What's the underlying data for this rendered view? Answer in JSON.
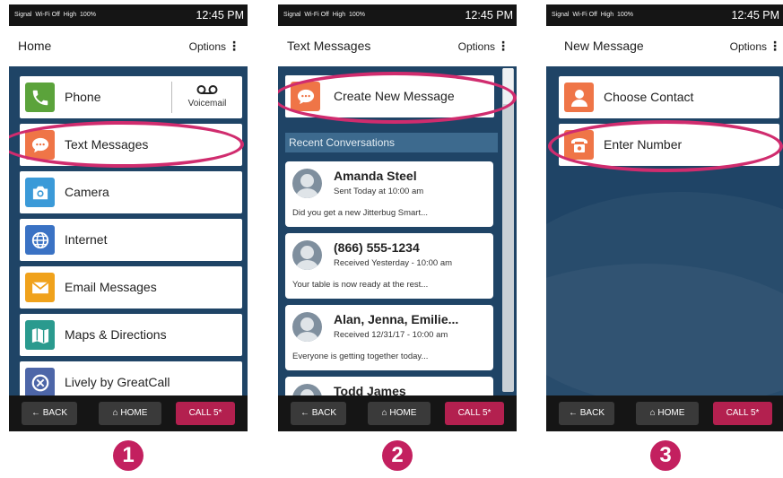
{
  "status_bar": {
    "signal": "Signal",
    "wifi": "Wi-Fi Off",
    "volume": "High",
    "battery": "100%",
    "time": "12:45 PM"
  },
  "nav": {
    "back": "BACK",
    "home": "HOME",
    "call": "CALL 5*"
  },
  "colors": {
    "background": "#1f4466",
    "highlight": "#d02c6e",
    "call_button": "#b3204f",
    "badge": "#c3205f"
  },
  "screen1": {
    "title": "Home",
    "options": "Options",
    "phone_label": "Phone",
    "voicemail_label": "Voicemail",
    "voicemail_icon": "voicemail-icon",
    "menu": [
      {
        "label": "Text Messages",
        "icon": "chat-bubble-icon",
        "color": "#ef7547"
      },
      {
        "label": "Camera",
        "icon": "camera-icon",
        "color": "#3b9ad8"
      },
      {
        "label": "Internet",
        "icon": "globe-icon",
        "color": "#3a72c4"
      },
      {
        "label": "Email Messages",
        "icon": "envelope-icon",
        "color": "#f0a21c"
      },
      {
        "label": "Maps & Directions",
        "icon": "map-icon",
        "color": "#2a9a8e"
      },
      {
        "label": "Lively by GreatCall",
        "icon": "lively-icon",
        "color": "#4d66a8"
      }
    ],
    "badge": "1"
  },
  "screen2": {
    "title": "Text Messages",
    "options": "Options",
    "create_label": "Create New Message",
    "section_label": "Recent Conversations",
    "conversations": [
      {
        "name": "Amanda Steel",
        "date": "Sent Today at 10:00 am",
        "preview": "Did you get a new Jitterbug Smart..."
      },
      {
        "name": "(866) 555-1234",
        "date": "Received Yesterday - 10:00 am",
        "preview": "Your table is now ready at the rest..."
      },
      {
        "name": "Alan, Jenna, Emilie...",
        "date": "Received 12/31/17 - 10:00 am",
        "preview": "Everyone is getting together today..."
      },
      {
        "name": "Todd James",
        "date": "",
        "preview": ""
      }
    ],
    "badge": "2"
  },
  "screen3": {
    "title": "New Message",
    "options": "Options",
    "choose_contact": "Choose Contact",
    "enter_number": "Enter Number",
    "badge": "3"
  }
}
